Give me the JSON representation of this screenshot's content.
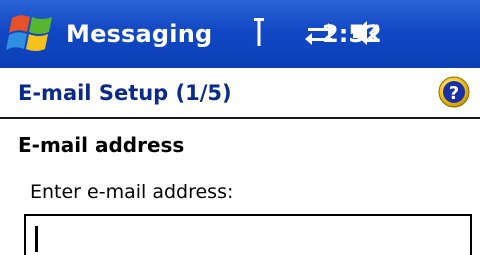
{
  "titlebar": {
    "app_title": "Messaging",
    "clock": "2:52",
    "icons": {
      "start": "windows-flag-icon",
      "signal": "signal-antenna-icon",
      "connectivity": "connectivity-arrows-icon",
      "volume": "speaker-volume-icon"
    }
  },
  "header": {
    "title": "E-mail Setup (1/5)",
    "help_icon": "help-icon"
  },
  "form": {
    "section_title": "E-mail address",
    "email_label": "Enter e-mail address:",
    "email_value": ""
  },
  "colors": {
    "titlebar_blue": "#1248c4",
    "header_text": "#0b2b8c",
    "help_yellow": "#f0c419",
    "help_blue": "#1b2fa8"
  }
}
